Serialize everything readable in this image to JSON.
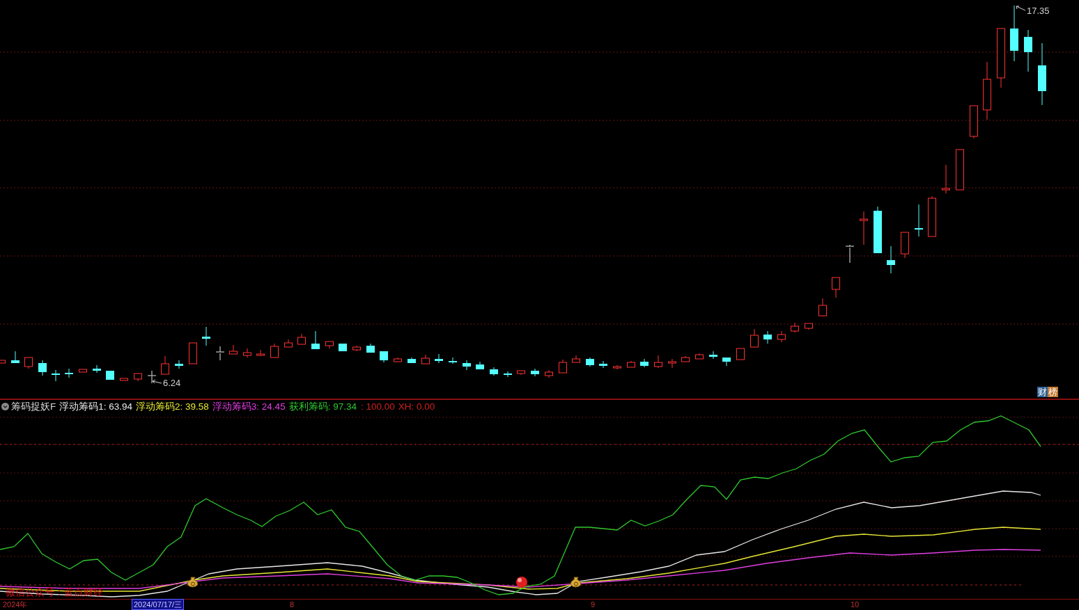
{
  "price_chart": {
    "high_label": "17.35",
    "low_label": "6.24",
    "badge": [
      {
        "text": "财",
        "color": "#2f5f93"
      },
      {
        "text": "榜",
        "color": "#c2782e"
      }
    ]
  },
  "indicator": {
    "legend": [
      {
        "text": "筹码捉妖F",
        "color": "#d8d8d8"
      },
      {
        "text": "浮动筹码1: 63.94",
        "color": "#e8e8e8"
      },
      {
        "text": "浮动筹码2: 39.58",
        "color": "#e8e836"
      },
      {
        "text": "浮动筹码3: 24.45",
        "color": "#e23ee2"
      },
      {
        "text": "获利筹码: 97.34",
        "color": "#2ec82e"
      },
      {
        "text": ": 100.00",
        "color": "#d22020"
      },
      {
        "text": "XH: 0.00",
        "color": "#d22020"
      }
    ],
    "overlay_text": "微信公众号：蓝点财经"
  },
  "time_axis": [
    {
      "label": "2024年",
      "selected": false
    },
    {
      "label": "2024/07/17/三",
      "selected": true
    },
    {
      "label": "8",
      "selected": false
    },
    {
      "label": "9",
      "selected": false
    },
    {
      "label": "10",
      "selected": false
    }
  ]
}
